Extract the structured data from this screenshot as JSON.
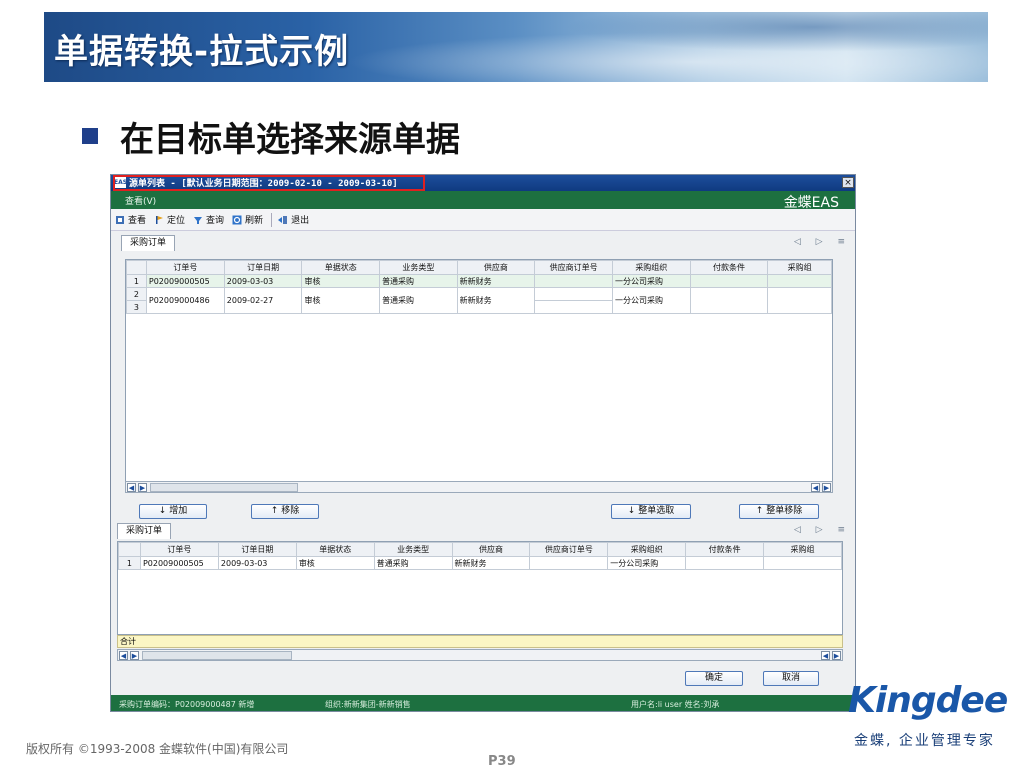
{
  "slide": {
    "title": "单据转换-拉式示例",
    "bullet": "在目标单选择来源单据",
    "copyright": "版权所有 ©1993-2008 金蝶软件(中国)有限公司",
    "page_number": "P39",
    "logo_text": "Kingdee",
    "slogan": "金蝶, 企业管理专家"
  },
  "window": {
    "icon_label": "EAS",
    "title": "源单列表 - [默认业务日期范围：2009-02-10 - 2009-03-10]",
    "close_glyph": "×",
    "menu_view": "查看(V)",
    "brand": "金蝶EAS",
    "toolbar": [
      {
        "icon": "view-icon",
        "label": "查看"
      },
      {
        "icon": "locate-icon",
        "label": "定位"
      },
      {
        "icon": "filter-icon",
        "label": "查询"
      },
      {
        "icon": "refresh-icon",
        "label": "刷新"
      },
      {
        "icon": "exit-icon",
        "label": "退出"
      }
    ],
    "top_tab": "采购订单",
    "bottom_tab": "采购订单",
    "tab_nav": "◁ ▷ ≡",
    "columns": [
      "订单号",
      "订单日期",
      "单据状态",
      "业务类型",
      "供应商",
      "供应商订单号",
      "采购组织",
      "付款条件",
      "采购组"
    ],
    "top_rows": [
      {
        "rn": "1",
        "cells": [
          "P02009000505",
          "2009-03-03",
          "审核",
          "普通采购",
          "新新财务",
          "",
          "一分公司采购",
          "",
          ""
        ]
      },
      {
        "rn": "2",
        "cells": [
          "P02009000486",
          "2009-02-27",
          "审核",
          "普通采购",
          "新新财务",
          "",
          "一分公司采购",
          "",
          ""
        ]
      },
      {
        "rn": "3",
        "cells": [
          "",
          "",
          "",
          "",
          "",
          "",
          "",
          "",
          ""
        ]
      }
    ],
    "bottom_rows": [
      {
        "rn": "1",
        "cells": [
          "P02009000505",
          "2009-03-03",
          "审核",
          "普通采购",
          "新新财务",
          "",
          "一分公司采购",
          "",
          ""
        ]
      }
    ],
    "buttons": {
      "add": "↓ 增加",
      "remove": "↑ 移除",
      "select_all": "↓ 整单选取",
      "remove_all": "↑ 整单移除",
      "ok": "确定",
      "cancel": "取消"
    },
    "total_label": "合计",
    "status_left": "采购订单编码：P02009000487 新增",
    "status_mid": "组织:新新集团-新新销售",
    "status_right": "用户名:li user 姓名:刘承"
  },
  "colors": {
    "title_bar": "#1d4e9c",
    "menu_green": "#1d7040",
    "highlight_red": "#e02020",
    "kingdee_blue": "#1a57a8"
  }
}
